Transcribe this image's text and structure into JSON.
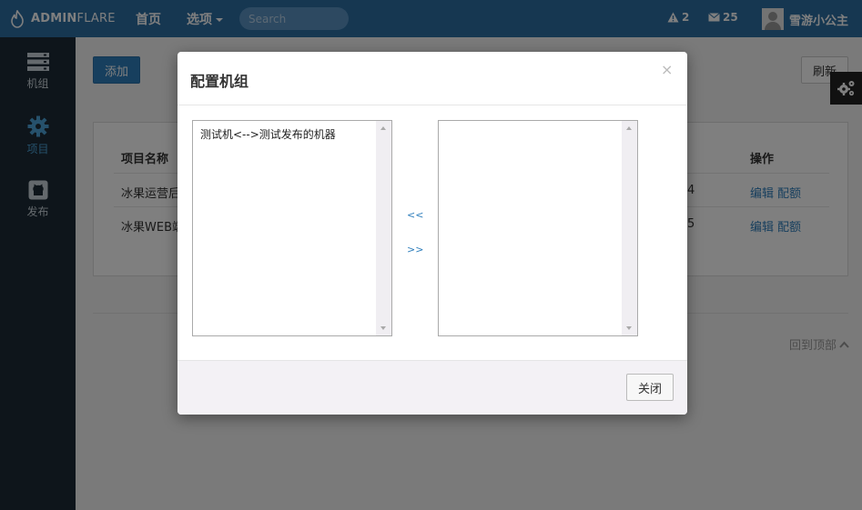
{
  "colors": {
    "navbar": "#2c6ea3",
    "sidebar": "#1c2b36",
    "accent": "#2e7ebc",
    "overlay": "rgba(0,0,0,0.5)"
  },
  "navbar": {
    "brand_bold": "ADMIN",
    "brand_light": "FLARE",
    "home": "首页",
    "options": "选项",
    "search_placeholder": "Search",
    "alert_count": "2",
    "message_count": "25",
    "user_name": "雪游小公主"
  },
  "sidebar": {
    "items": [
      {
        "label": "机组",
        "icon": "server-icon"
      },
      {
        "label": "项目",
        "icon": "gear-icon"
      },
      {
        "label": "发布",
        "icon": "github-icon"
      }
    ]
  },
  "toolbar": {
    "add_label": "添加",
    "refresh_label": "刷新"
  },
  "table": {
    "headers": {
      "name": "项目名称",
      "operations": "操作"
    },
    "rows": [
      {
        "name": "冰果运营后",
        "num": "4",
        "ops": [
          "编辑",
          "配额"
        ]
      },
      {
        "name": "冰果WEB端",
        "num": "5",
        "ops": [
          "编辑",
          "配额"
        ]
      }
    ]
  },
  "back_to_top": "回到顶部",
  "modal": {
    "title": "配置机组",
    "close_icon": "×",
    "left_options": [
      "测试机<-->测试发布的机器"
    ],
    "right_options": [],
    "move_left": "<<",
    "move_right": ">>",
    "close_button": "关闭"
  }
}
